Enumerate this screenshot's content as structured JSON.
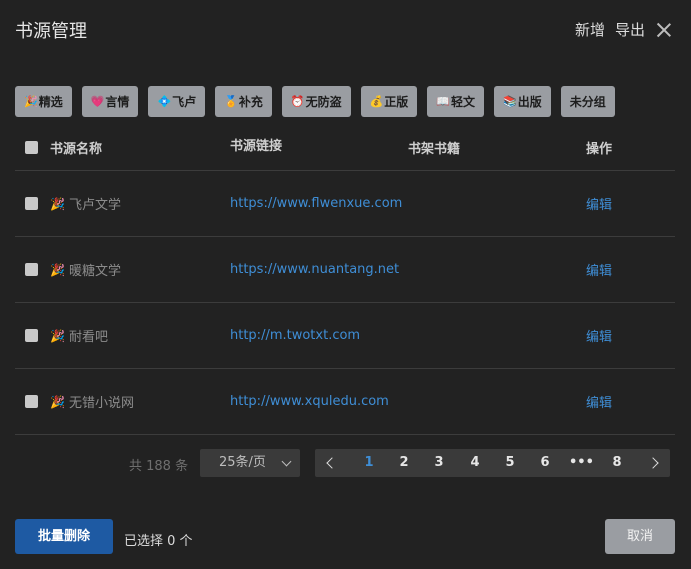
{
  "header": {
    "title": "书源管理",
    "actions": {
      "add": "新增",
      "export": "导出"
    }
  },
  "tags": [
    {
      "emoji": "🎉",
      "label": "精选"
    },
    {
      "emoji": "💗",
      "label": "言情"
    },
    {
      "emoji": "💠",
      "label": "飞卢"
    },
    {
      "emoji": "🏅",
      "label": "补充"
    },
    {
      "emoji": "⏰",
      "label": "无防盗"
    },
    {
      "emoji": "💰",
      "label": "正版"
    },
    {
      "emoji": "📖",
      "label": "轻文"
    },
    {
      "emoji": "📚",
      "label": "出版"
    },
    {
      "emoji": "",
      "label": "未分组"
    }
  ],
  "table": {
    "columns": [
      "书源名称",
      "书源链接",
      "书架书籍",
      "操作"
    ],
    "rows": [
      {
        "name": "飞卢文学",
        "url": "https://www.flwenxue.com",
        "shelf": "",
        "action": "编辑"
      },
      {
        "name": "暖糖文学",
        "url": "https://www.nuantang.net",
        "shelf": "",
        "action": "编辑"
      },
      {
        "name": "耐看吧",
        "url": "http://m.twotxt.com",
        "shelf": "",
        "action": "编辑"
      },
      {
        "name": "无错小说网",
        "url": "http://www.xquledu.com",
        "shelf": "",
        "action": "编辑"
      }
    ],
    "row_icon": "🎉"
  },
  "pagination": {
    "total": "共 188 条",
    "page_size": "25条/页",
    "pages": [
      "1",
      "2",
      "3",
      "4",
      "5",
      "6",
      "•••",
      "8"
    ],
    "current": "1"
  },
  "footer": {
    "delete_label": "批量删除",
    "selected_text": "已选择 0 个",
    "cancel_label": "取消"
  },
  "colors": {
    "accent": "#3f8ed6",
    "primary_button": "#1e5aa3",
    "background": "#222222"
  }
}
